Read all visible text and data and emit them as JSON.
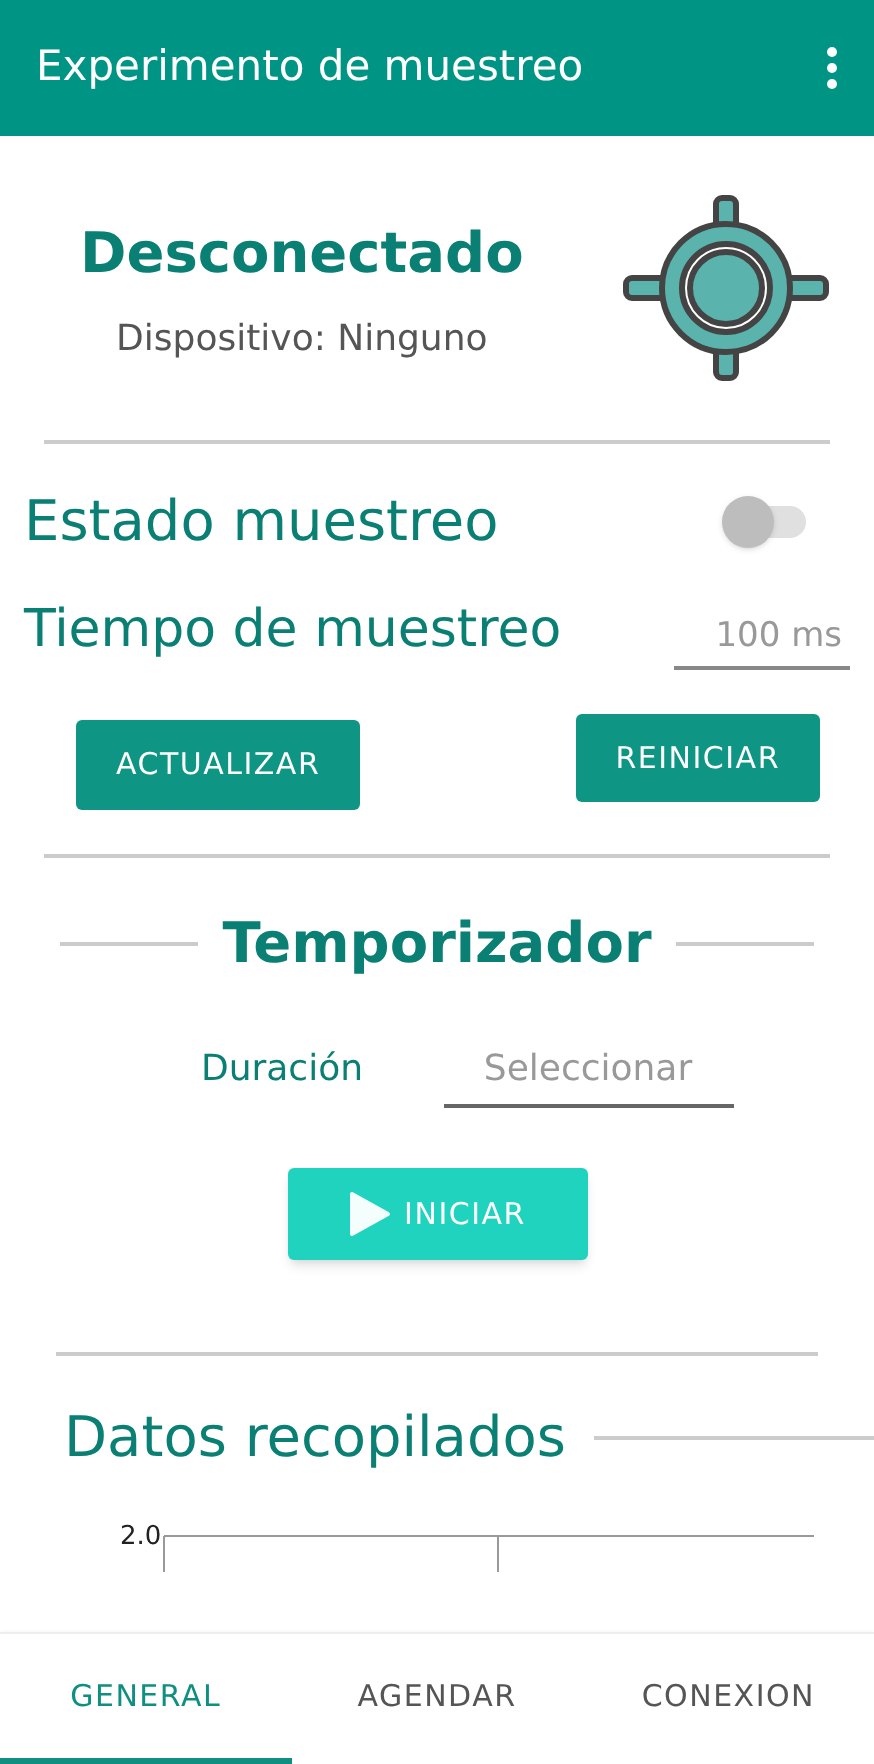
{
  "app_bar": {
    "title": "Experimento de muestreo"
  },
  "connection": {
    "status": "Desconectado",
    "device": "Dispositivo: Ninguno"
  },
  "sampling": {
    "label": "Estado muestreo",
    "on": false,
    "time_label": "Tiempo de muestreo",
    "time_value": "100 ms"
  },
  "buttons": [
    "ACTUALIZAR",
    "REINICIAR"
  ],
  "timer": {
    "title": "Temporizador",
    "duration_label": "Duración",
    "duration_placeholder": "Seleccionar",
    "start_button": "INICIAR"
  },
  "data": {
    "title": "Datos recopilados",
    "y_tick": "2.0"
  },
  "tabs": [
    {
      "label": "GENERAL",
      "selected": true
    },
    {
      "label": "AGENDAR",
      "selected": false
    },
    {
      "label": "CONEXION",
      "selected": false
    }
  ]
}
